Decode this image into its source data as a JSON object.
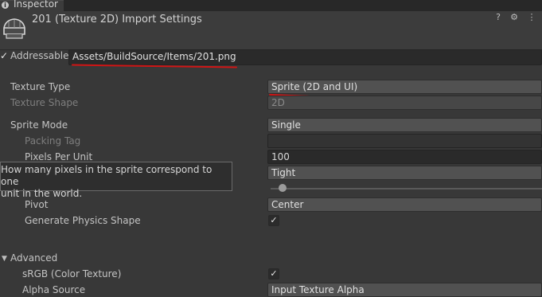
{
  "tab": {
    "label": "Inspector"
  },
  "header": {
    "title": "201 (Texture 2D) Import Settings"
  },
  "addressable": {
    "label": "Addressable",
    "checked": true,
    "path": "Assets/BuildSource/Items/201.png"
  },
  "properties": {
    "texture_type": {
      "label": "Texture Type",
      "value": "Sprite (2D and UI)"
    },
    "texture_shape": {
      "label": "Texture Shape",
      "value": "2D"
    },
    "sprite_mode": {
      "label": "Sprite Mode",
      "value": "Single"
    },
    "packing_tag": {
      "label": "Packing Tag",
      "value": ""
    },
    "pixels_per_unit": {
      "label": "Pixels Per Unit",
      "value": "100"
    },
    "mesh_type": {
      "value": "Tight"
    },
    "pivot": {
      "label": "Pivot",
      "value": "Center"
    },
    "generate_physics_shape": {
      "label": "Generate Physics Shape",
      "checked": true
    }
  },
  "tooltip": {
    "line1": "How many pixels in the sprite correspond to one",
    "line2": "unit in the world."
  },
  "advanced": {
    "label": "Advanced",
    "srgb": {
      "label": "sRGB (Color Texture)",
      "checked": true
    },
    "alpha_source": {
      "label": "Alpha Source",
      "value": "Input Texture Alpha"
    }
  },
  "icons": [
    "info-icon",
    "texture-thumbnail",
    "help-icon",
    "settings-icon",
    "menu-icon",
    "checkmark-icon",
    "foldout-arrow-icon"
  ],
  "colors": {
    "panel": "#383838",
    "field": "#2a2a2a",
    "dropdown": "#515151",
    "annotation_red": "#d01515"
  }
}
